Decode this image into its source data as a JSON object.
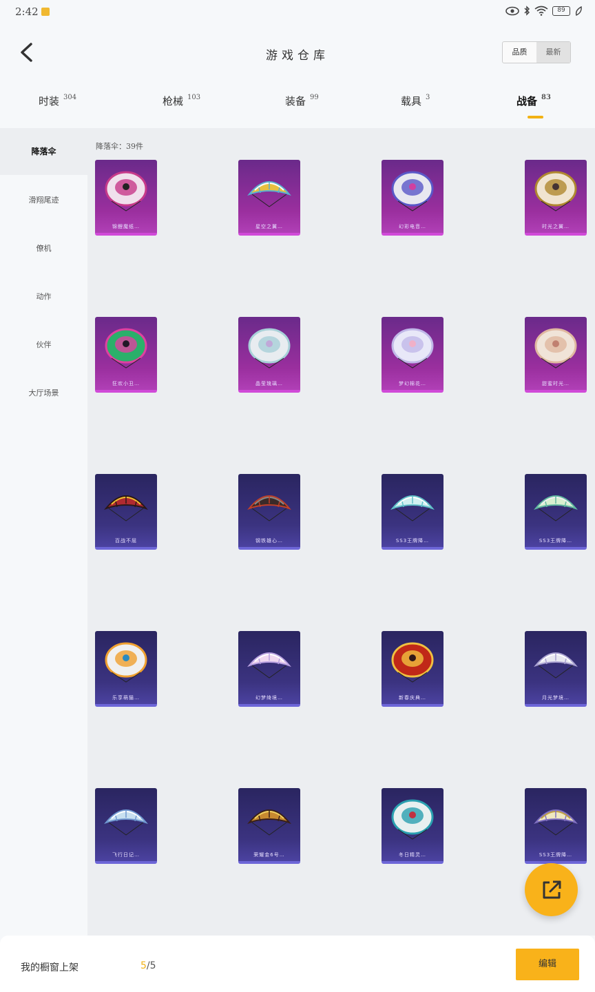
{
  "status_bar": {
    "time": "2:42",
    "battery": "89"
  },
  "header": {
    "title": "游戏仓库",
    "toggle": {
      "left": "品质",
      "right": "最新"
    }
  },
  "tabs": [
    {
      "label": "时装",
      "count": "304"
    },
    {
      "label": "枪械",
      "count": "103"
    },
    {
      "label": "装备",
      "count": "99"
    },
    {
      "label": "载具",
      "count": "3"
    },
    {
      "label": "战备",
      "count": "83",
      "active": true
    }
  ],
  "sidebar": {
    "items": [
      {
        "label": "降落伞",
        "active": true
      },
      {
        "label": "滑翔尾迹"
      },
      {
        "label": "僚机"
      },
      {
        "label": "动作"
      },
      {
        "label": "伙伴"
      },
      {
        "label": "大厅场景"
      }
    ]
  },
  "content": {
    "count_label": "降落伞：39件",
    "items": [
      {
        "name": "锦鲤魔纸…",
        "tier": "purple",
        "icon": "parachute-round-pink-cat"
      },
      {
        "name": "星空之翼…",
        "tier": "purple",
        "icon": "parachute-wing-gold"
      },
      {
        "name": "幻彩电音…",
        "tier": "purple",
        "icon": "parachute-round-graffiti"
      },
      {
        "name": "时光之翼…",
        "tier": "purple",
        "icon": "parachute-round-gold-frame"
      },
      {
        "name": "狂欢小丑…",
        "tier": "purple",
        "icon": "parachute-round-clown"
      },
      {
        "name": "晶莹琉璃…",
        "tier": "purple",
        "icon": "parachute-round-crystal"
      },
      {
        "name": "梦幻棉花…",
        "tier": "purple",
        "icon": "parachute-round-lavender"
      },
      {
        "name": "甜蜜时光…",
        "tier": "purple",
        "icon": "parachute-round-cream"
      },
      {
        "name": "百战不屈",
        "tier": "blue",
        "icon": "parachute-wing-red"
      },
      {
        "name": "钢铁雄心…",
        "tier": "blue",
        "icon": "parachute-wing-black-red"
      },
      {
        "name": "SS3王牌降…",
        "tier": "blue",
        "icon": "parachute-wing-cyan"
      },
      {
        "name": "SS3王牌降…",
        "tier": "blue",
        "icon": "parachute-wing-green"
      },
      {
        "name": "乐享萌猫…",
        "tier": "blue",
        "icon": "parachute-round-owl"
      },
      {
        "name": "幻梦绮境…",
        "tier": "blue",
        "icon": "parachute-wing-pink"
      },
      {
        "name": "新春庆典…",
        "tier": "blue",
        "icon": "parachute-round-red"
      },
      {
        "name": "月光梦境…",
        "tier": "blue",
        "icon": "parachute-wing-silver"
      },
      {
        "name": "飞行日记…",
        "tier": "blue",
        "icon": "parachute-wing-blue"
      },
      {
        "name": "荣耀金6号…",
        "tier": "blue",
        "icon": "parachute-wing-brown"
      },
      {
        "name": "冬日精灵…",
        "tier": "blue",
        "icon": "parachute-round-teal"
      },
      {
        "name": "SS3王牌降…",
        "tier": "blue",
        "icon": "parachute-wing-gold-stripe"
      }
    ]
  },
  "bottom_bar": {
    "label": "我的橱窗上架",
    "current": "5",
    "total": "/5",
    "edit_label": "编辑"
  },
  "colors": {
    "accent": "#f9b21a",
    "purple_tier": "#9a2f9e",
    "blue_tier": "#3b3380"
  }
}
